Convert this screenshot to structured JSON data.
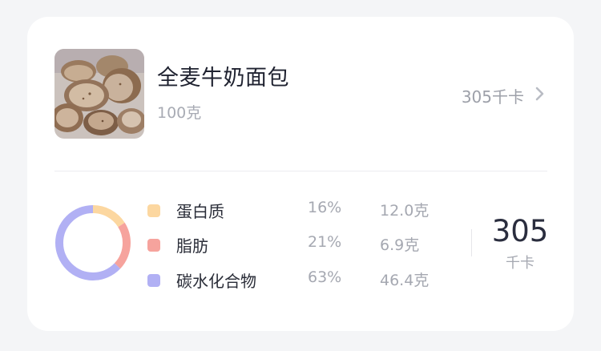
{
  "food": {
    "name": "全麦牛奶面包",
    "amount": "100克",
    "kcal": "305千卡",
    "image_icon": "bread-photo",
    "chevron_icon": "chevron-right-icon"
  },
  "nutrition": {
    "items": [
      {
        "name": "蛋白质",
        "percent": "16%",
        "grams": "12.0克",
        "color": "#fcd7a0"
      },
      {
        "name": "脂肪",
        "percent": "21%",
        "grams": "6.9克",
        "color": "#f6a39d"
      },
      {
        "name": "碳水化合物",
        "percent": "63%",
        "grams": "46.4克",
        "color": "#b1b0f4"
      }
    ],
    "total": "305",
    "total_unit": "千卡"
  },
  "chart_data": {
    "type": "pie",
    "donut": true,
    "categories": [
      "蛋白质",
      "脂肪",
      "碳水化合物"
    ],
    "values": [
      16,
      21,
      63
    ],
    "colors": [
      "#fcd7a0",
      "#f6a39d",
      "#b1b0f4"
    ],
    "legend_placement": "right"
  }
}
